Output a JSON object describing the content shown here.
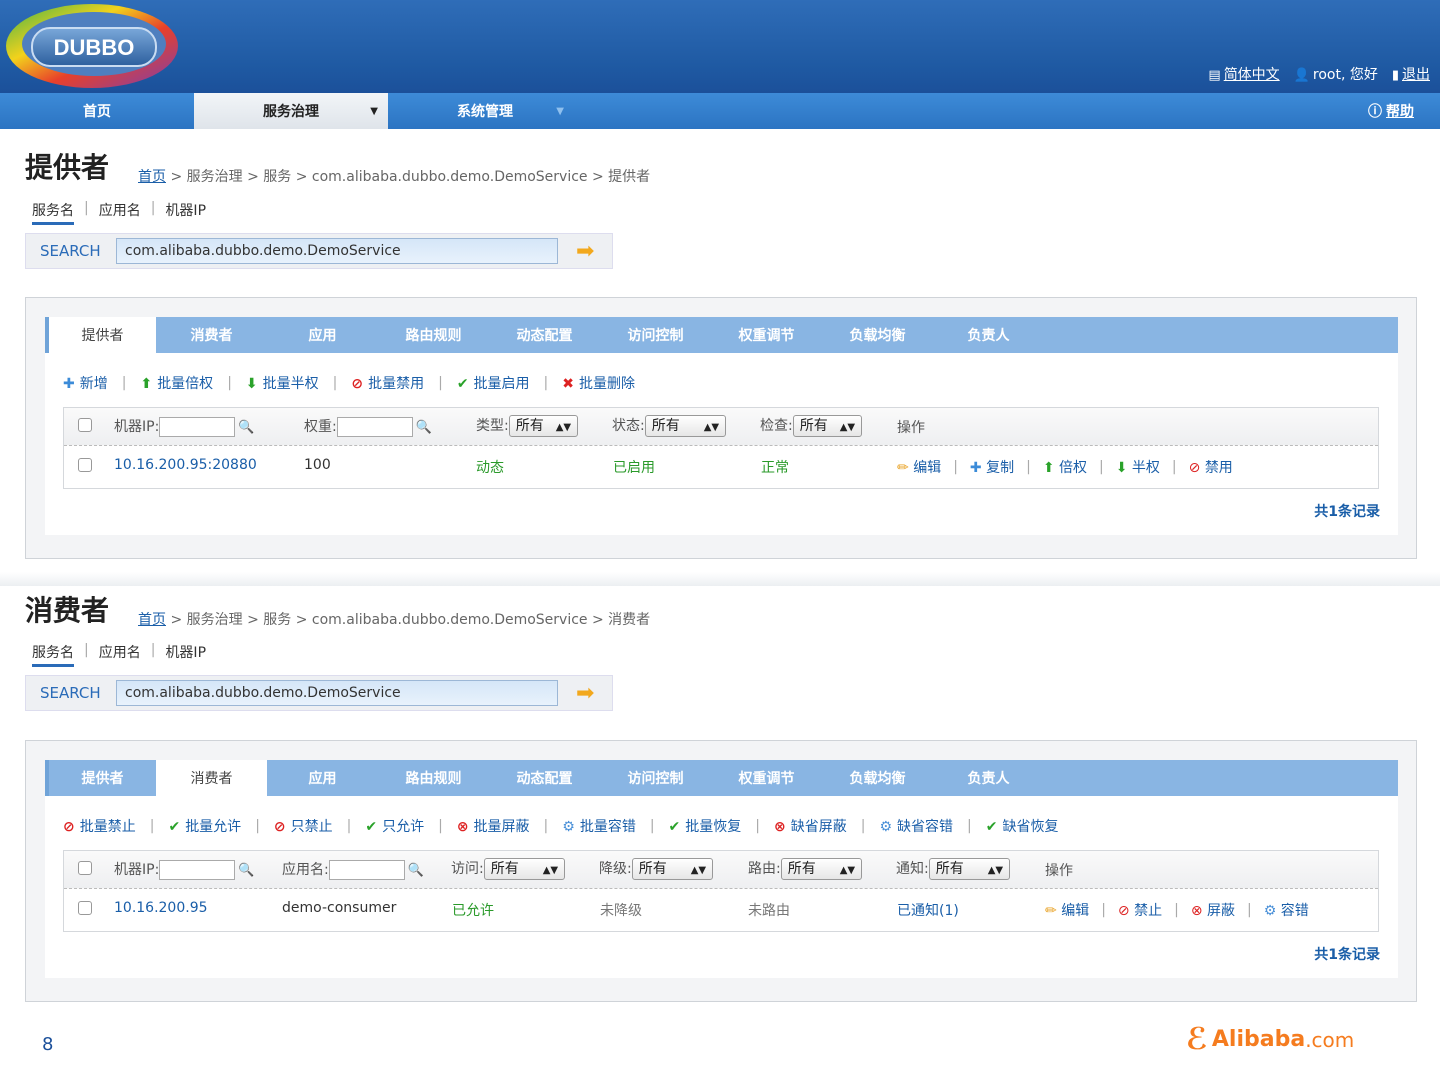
{
  "header": {
    "logo_text": "DUBBO",
    "language": "简体中文",
    "greeting": "root, 您好",
    "logout": "退出"
  },
  "nav": {
    "items": [
      "首页",
      "服务治理",
      "系统管理"
    ],
    "help": "帮助"
  },
  "providers": {
    "title": "提供者",
    "breadcrumb_home": "首页",
    "breadcrumb_rest": " > 服务治理 > 服务 > com.alibaba.dubbo.demo.DemoService > 提供者",
    "sub_tabs": [
      "服务名",
      "应用名",
      "机器IP"
    ],
    "search_label": "SEARCH",
    "search_value": "com.alibaba.dubbo.demo.DemoService",
    "tabs": [
      "提供者",
      "消费者",
      "应用",
      "路由规则",
      "动态配置",
      "访问控制",
      "权重调节",
      "负载均衡",
      "负责人"
    ],
    "toolbar": [
      "新增",
      "批量倍权",
      "批量半权",
      "批量禁用",
      "批量启用",
      "批量删除"
    ],
    "headers": {
      "ip": "机器IP:",
      "weight": "权重:",
      "type": "类型:",
      "status": "状态:",
      "check": "检查:",
      "ops": "操作",
      "all": "所有"
    },
    "row": {
      "address": "10.16.200.95:20880",
      "weight": "100",
      "type": "动态",
      "status": "已启用",
      "check": "正常",
      "ops": [
        "编辑",
        "复制",
        "倍权",
        "半权",
        "禁用"
      ]
    },
    "records": "共1条记录"
  },
  "consumers": {
    "title": "消费者",
    "breadcrumb_home": "首页",
    "breadcrumb_rest": " > 服务治理 > 服务 > com.alibaba.dubbo.demo.DemoService > 消费者",
    "sub_tabs": [
      "服务名",
      "应用名",
      "机器IP"
    ],
    "search_label": "SEARCH",
    "search_value": "com.alibaba.dubbo.demo.DemoService",
    "tabs": [
      "提供者",
      "消费者",
      "应用",
      "路由规则",
      "动态配置",
      "访问控制",
      "权重调节",
      "负载均衡",
      "负责人"
    ],
    "toolbar": [
      "批量禁止",
      "批量允许",
      "只禁止",
      "只允许",
      "批量屏蔽",
      "批量容错",
      "批量恢复",
      "缺省屏蔽",
      "缺省容错",
      "缺省恢复"
    ],
    "headers": {
      "ip": "机器IP:",
      "app": "应用名:",
      "access": "访问:",
      "degrade": "降级:",
      "route": "路由:",
      "notify": "通知:",
      "ops": "操作",
      "all": "所有"
    },
    "row": {
      "address": "10.16.200.95",
      "app": "demo-consumer",
      "access": "已允许",
      "degrade": "未降级",
      "route": "未路由",
      "notify": "已通知(1)",
      "ops": [
        "编辑",
        "禁止",
        "屏蔽",
        "容错"
      ]
    },
    "records": "共1条记录"
  },
  "footer": {
    "page_number": "8",
    "company": "Alibaba",
    "company_suffix": ".com"
  }
}
